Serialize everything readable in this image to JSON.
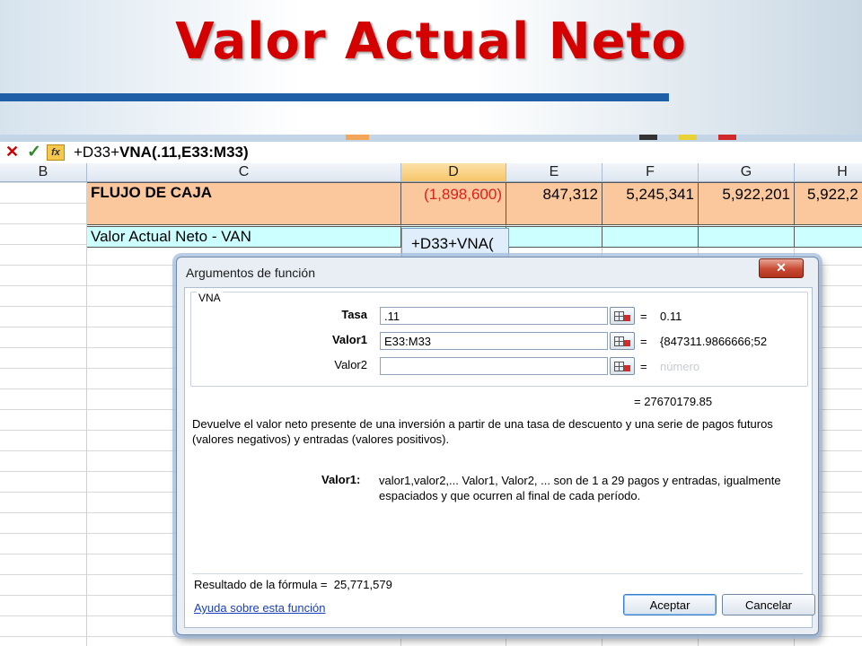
{
  "slide": {
    "title": "Valor Actual Neto"
  },
  "formula_bar": {
    "prefix": "+D33+",
    "function_part": "VNA(.11,E33:M33)"
  },
  "columns": [
    {
      "label": "B",
      "selected": false
    },
    {
      "label": "C",
      "selected": false
    },
    {
      "label": "D",
      "selected": true
    },
    {
      "label": "E",
      "selected": false
    },
    {
      "label": "F",
      "selected": false
    },
    {
      "label": "G",
      "selected": false
    },
    {
      "label": "H",
      "selected": false
    }
  ],
  "sheet": {
    "flujo_label": "FLUJO DE CAJA",
    "flujo_values": [
      "(1,898,600)",
      "847,312",
      "5,245,341",
      "5,922,201",
      "5,922,2"
    ],
    "van_label": "Valor Actual Neto - VAN",
    "editing_text": "+D33+VNA(",
    "negative_color": "#e0201c",
    "header_fill": "#fbc79c",
    "van_fill": "#ccffff"
  },
  "dialog": {
    "title": "Argumentos de función",
    "function_name": "VNA",
    "args": [
      {
        "label": "Tasa",
        "value": ".11",
        "result": "0.11",
        "bold": true
      },
      {
        "label": "Valor1",
        "value": "E33:M33",
        "result": "{847311.9866666;52",
        "bold": true
      },
      {
        "label": "Valor2",
        "value": "",
        "result": "número",
        "bold": false
      }
    ],
    "equals": "=",
    "total": "27670179.85",
    "description": "Devuelve el valor neto presente de una inversión a partir de una tasa de descuento y una serie de pagos futuros (valores negativos) y entradas (valores positivos).",
    "help_label": "Valor1:",
    "help_text": "valor1,valor2,... Valor1, Valor2, ... son de 1 a 29 pagos y entradas, igualmente espaciados y que ocurren al final de cada período.",
    "result_label": "Resultado de la fórmula =",
    "result_value": "25,771,579",
    "help_link": "Ayuda sobre esta función",
    "ok_label": "Aceptar",
    "cancel_label": "Cancelar",
    "close_glyph": "✕"
  },
  "toolbar": {
    "cancel_glyph": "✕",
    "enter_glyph": "✓",
    "fx_label": "fx"
  }
}
